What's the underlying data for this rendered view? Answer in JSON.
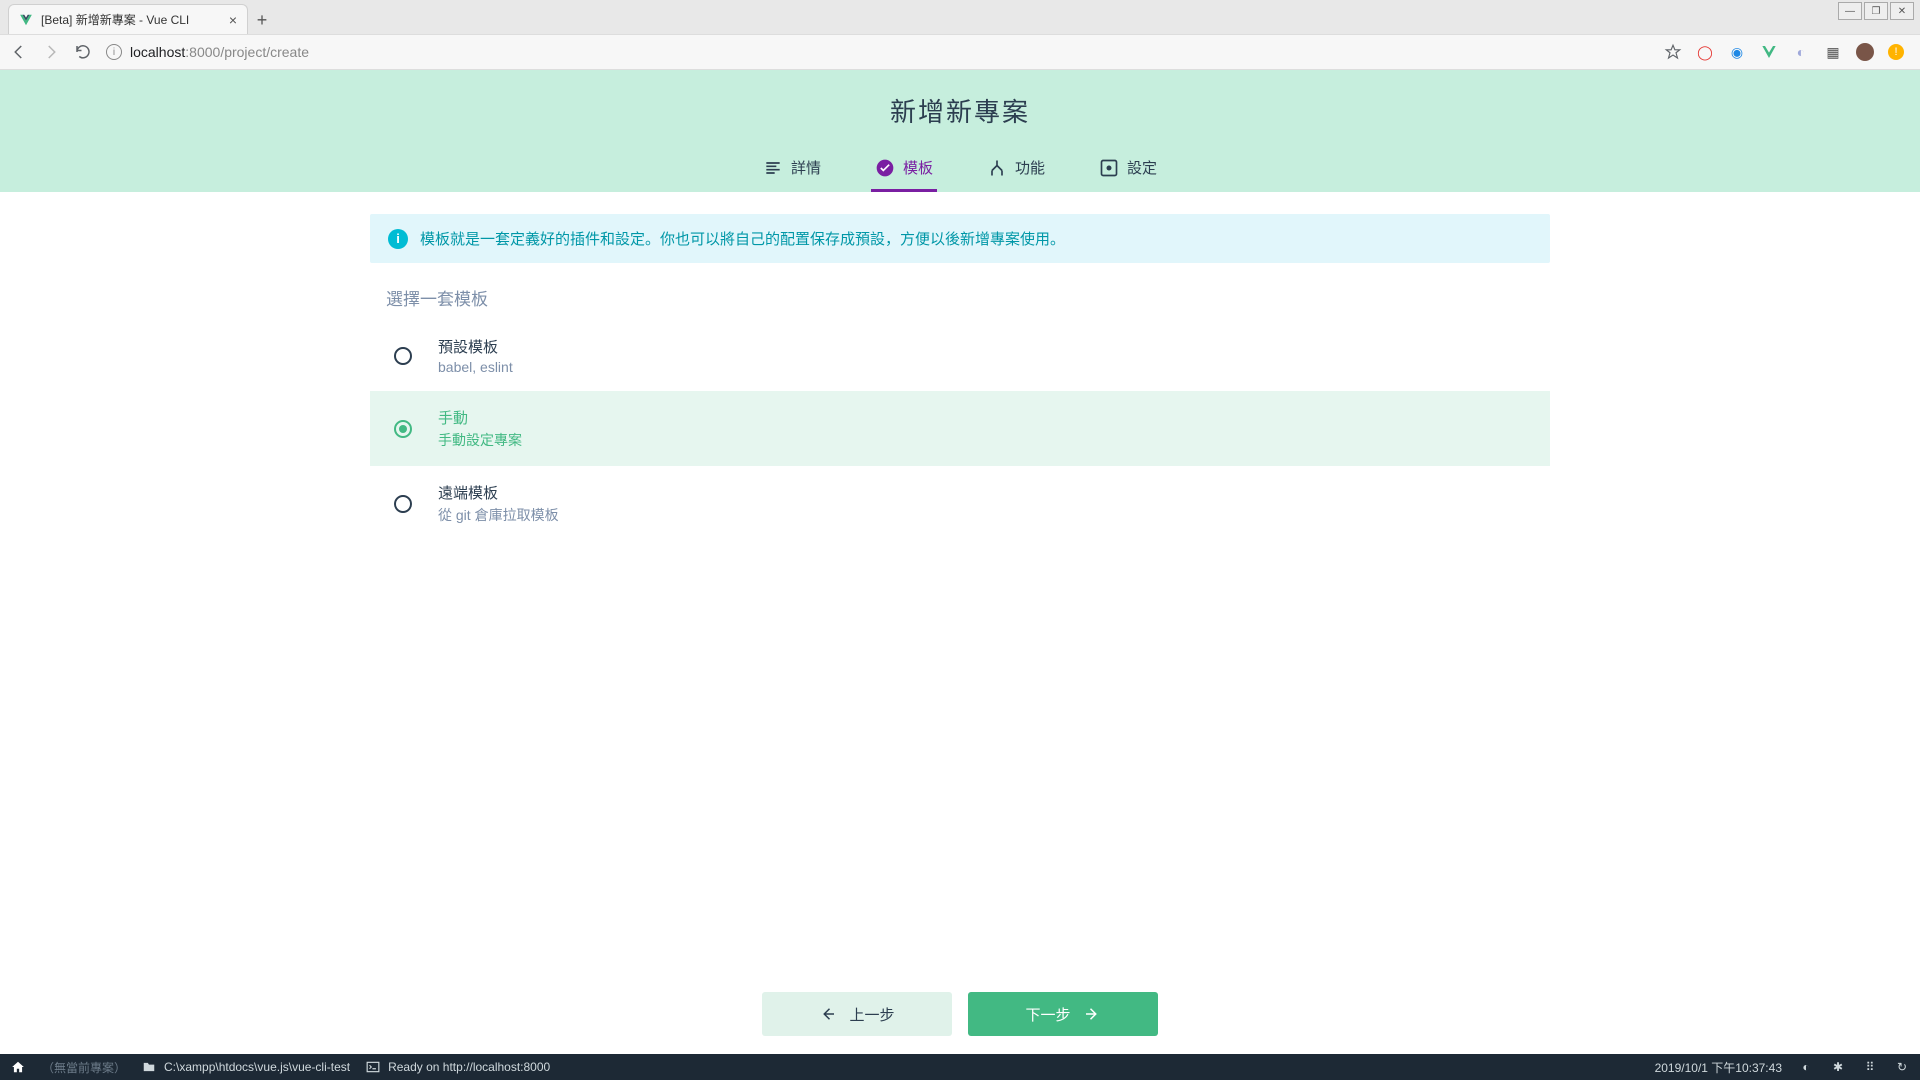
{
  "browser": {
    "tab_title": "[Beta] 新增新專案 - Vue CLI",
    "url_host": "localhost",
    "url_port": ":8000",
    "url_path": "/project/create"
  },
  "header": {
    "title": "新增新專案",
    "steps": {
      "details": "詳情",
      "presets": "模板",
      "features": "功能",
      "config": "設定"
    }
  },
  "info_banner": "模板就是一套定義好的插件和設定。你也可以將自己的配置保存成預設，方便以後新增專案使用。",
  "section_title": "選擇一套模板",
  "presets": {
    "default": {
      "title": "預設模板",
      "desc": "babel, eslint"
    },
    "manual": {
      "title": "手動",
      "desc": "手動設定專案"
    },
    "remote": {
      "title": "遠端模板",
      "desc": "從 git 倉庫拉取模板"
    }
  },
  "buttons": {
    "prev": "上一步",
    "next": "下一步"
  },
  "status": {
    "no_project": "（無當前專案）",
    "path": "C:\\xampp\\htdocs\\vue.js\\vue-cli-test",
    "ready": "Ready on http://localhost:8000",
    "clock": "2019/10/1 下午10:37:43"
  }
}
